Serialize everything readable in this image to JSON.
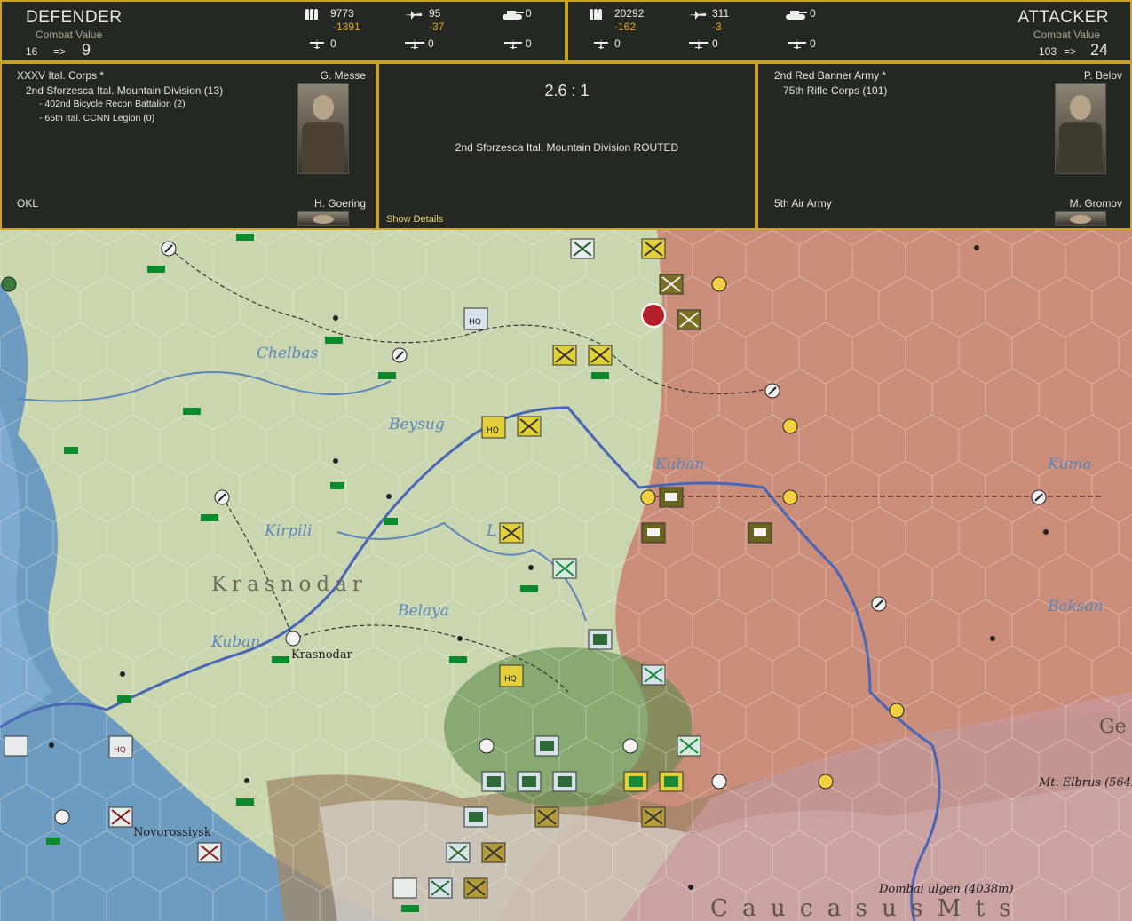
{
  "header": {
    "defender": {
      "title": "DEFENDER",
      "cv_label": "Combat Value",
      "cv_before": "16",
      "arrow": "=>",
      "cv_after": "9",
      "infantry": "9773",
      "infantry_loss": "-1391",
      "aircraft": "95",
      "aircraft_loss": "-37",
      "tanks": "0",
      "row2_a": "0",
      "row2_b": "0",
      "row2_c": "0"
    },
    "attacker": {
      "title": "ATTACKER",
      "cv_label": "Combat Value",
      "cv_before": "103",
      "arrow": "=>",
      "cv_after": "24",
      "infantry": "20292",
      "infantry_loss": "-162",
      "aircraft": "311",
      "aircraft_loss": "-3",
      "tanks": "0",
      "row2_a": "0",
      "row2_b": "0",
      "row2_c": "0"
    }
  },
  "defender_panel": {
    "corps": "XXXV Ital. Corps *",
    "commander": "G. Messe",
    "division": "2nd Sforzesca Ital. Mountain Division (13)",
    "sub1": "- 402nd Bicycle Recon Battalion (2)",
    "sub2": "- 65th Ital. CCNN Legion (0)",
    "air": "OKL",
    "air_commander": "H. Goering"
  },
  "result_panel": {
    "odds": "2.6 : 1",
    "result": "2nd Sforzesca Ital. Mountain Division ROUTED",
    "details_link": "Show Details"
  },
  "attacker_panel": {
    "army": "2nd Red Banner Army *",
    "commander": "P. Belov",
    "corps": "75th Rifle Corps (101)",
    "air": "5th Air Army",
    "air_commander": "M. Gromov"
  },
  "map": {
    "labels": {
      "chelbas": "Chelbas",
      "beysug": "Beysug",
      "kuban1": "Kuban",
      "kuban2": "Kuban",
      "kirpili": "Kirpili",
      "belaya": "Belaya",
      "kuma": "Kuma",
      "baksan": "Baksan",
      "krasnodar_region": "Krasnodar",
      "krasnodar_city": "Krasnodar",
      "novorossiysk": "Novorossiysk",
      "elbrus": "Mt. Elbrus (5642",
      "dombai": "Dombai ulgen (4038m)",
      "caucasus": "C a u c a s u s   M t s",
      "ge": "Ge",
      "li": "L"
    },
    "colors": {
      "land": "#c9d6b0",
      "sea": "#6e9cc0",
      "soviet": "#c98d7a",
      "river": "#4a67b5",
      "axis_unit": "#e2cf3a",
      "soviet_unit": "#6f6b1e"
    }
  }
}
